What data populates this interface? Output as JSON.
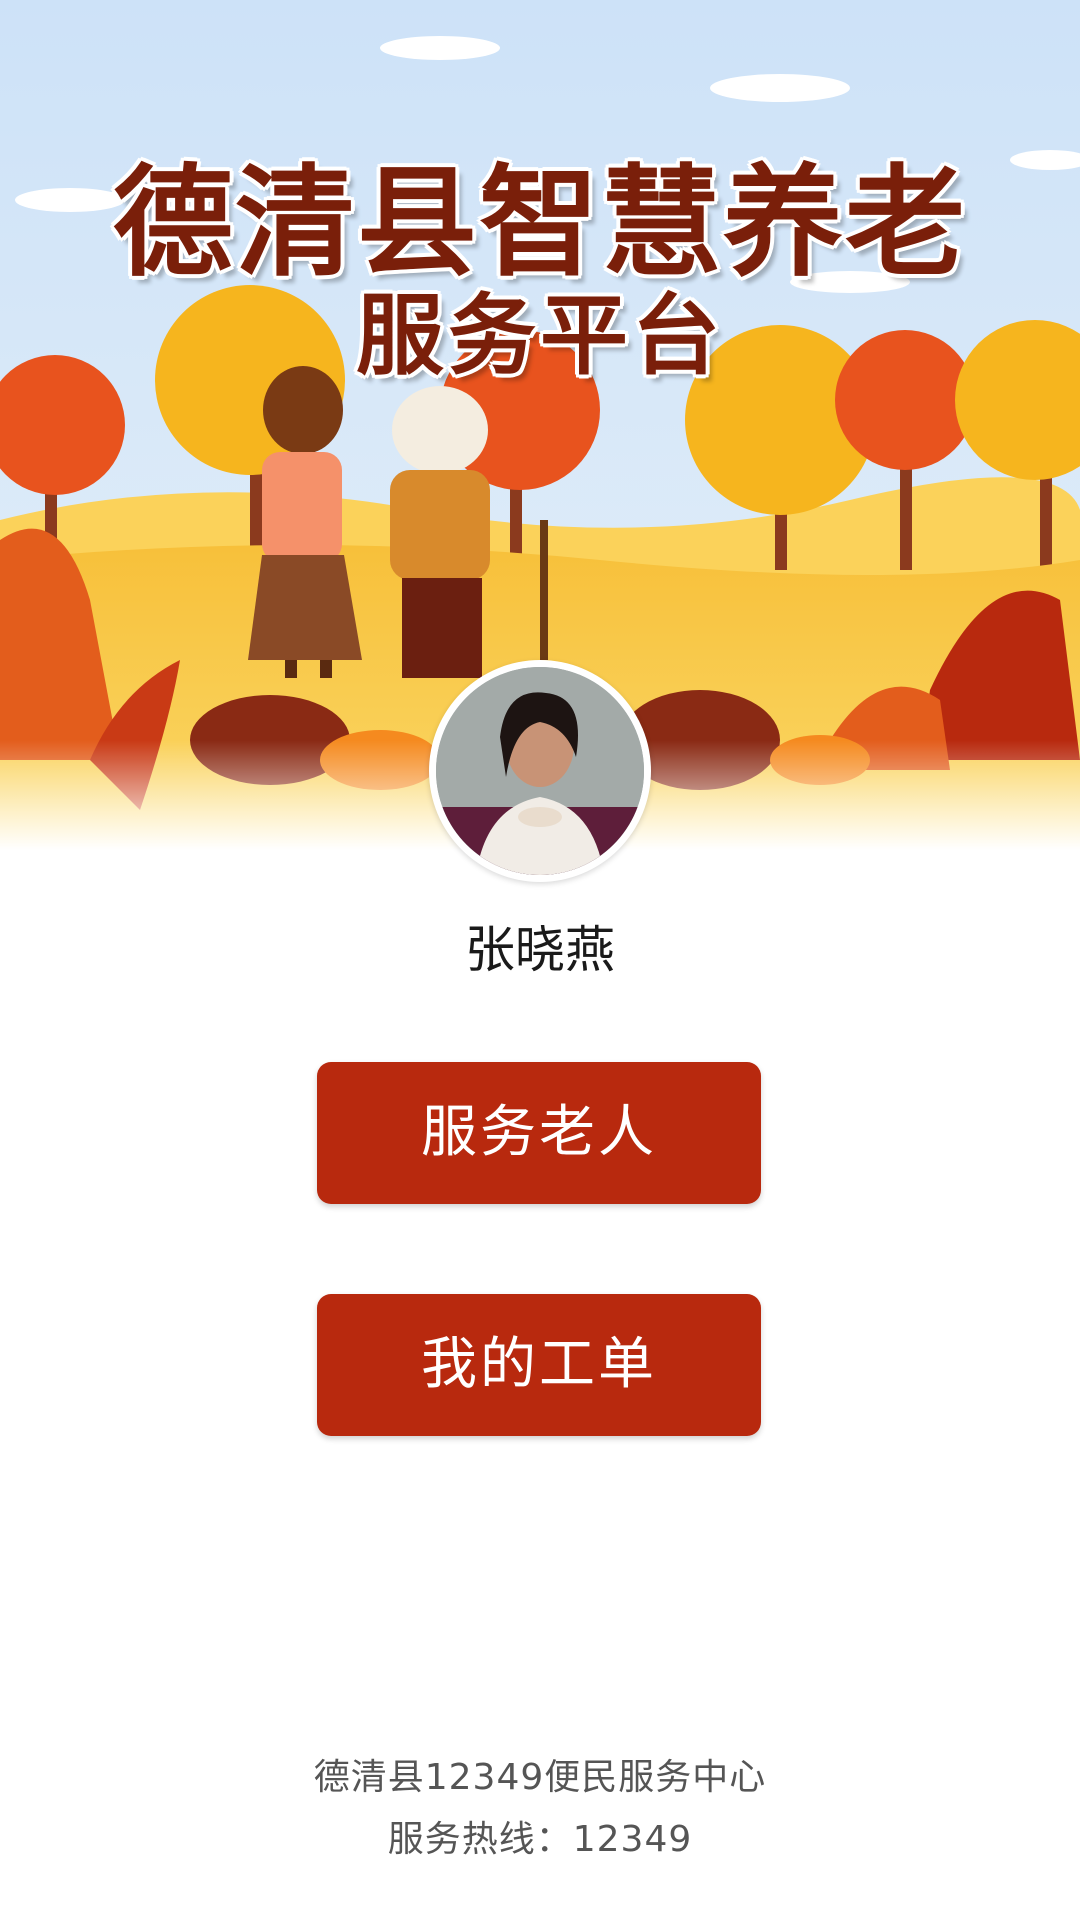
{
  "hero": {
    "title_line1": "德清县智慧养老",
    "title_line2": "服务平台"
  },
  "user": {
    "name": "张晓燕"
  },
  "actions": {
    "serve_elders": "服务老人",
    "my_orders": "我的工单"
  },
  "footer": {
    "center": "德清县12349便民服务中心",
    "hotline": "服务热线：12349"
  },
  "colors": {
    "accent": "#b8290e",
    "title": "#7a1f0a",
    "sky": "#cfe3f7"
  }
}
